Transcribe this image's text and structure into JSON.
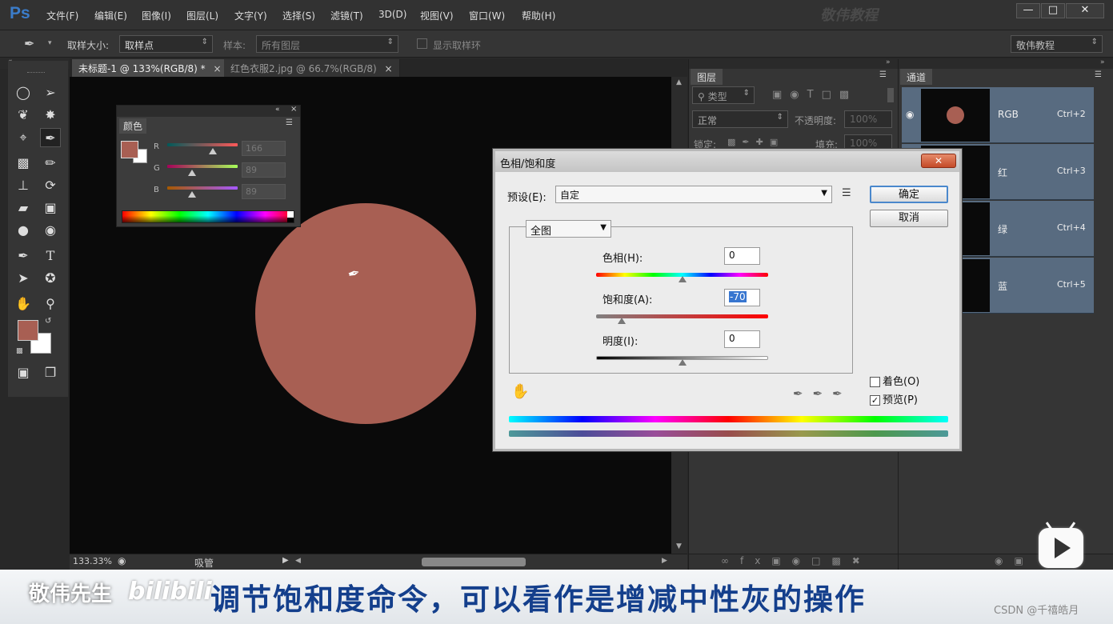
{
  "app": {
    "logo": "Ps",
    "watermark_top": "敬伟教程",
    "window_controls": [
      "—",
      "□",
      "✕"
    ]
  },
  "menu": [
    "文件(F)",
    "编辑(E)",
    "图像(I)",
    "图层(L)",
    "文字(Y)",
    "选择(S)",
    "滤镜(T)",
    "3D(D)",
    "视图(V)",
    "窗口(W)",
    "帮助(H)"
  ],
  "options": {
    "sample_size_label": "取样大小:",
    "sample_size_value": "取样点",
    "sample_label": "样本:",
    "sample_value": "所有图层",
    "show_ring_label": "显示取样环",
    "workspace_value": "敬伟教程"
  },
  "tabs": [
    {
      "label": "未标题-1 @ 133%(RGB/8) *",
      "active": true
    },
    {
      "label": "红色衣服2.jpg @ 66.7%(RGB/8)",
      "active": false
    }
  ],
  "status": {
    "zoom": "133.33%",
    "tool": "吸管"
  },
  "color_panel": {
    "title": "颜色",
    "foreground": "#a85f53",
    "background": "#ffffff",
    "sliders": [
      {
        "label": "R",
        "value": "166",
        "fraction": 0.65
      },
      {
        "label": "G",
        "value": "89",
        "fraction": 0.35
      },
      {
        "label": "B",
        "value": "89",
        "fraction": 0.35
      }
    ]
  },
  "canvas": {
    "circle_color": "#a85f53",
    "bg_color": "#0a0a0a"
  },
  "dialog": {
    "title": "色相/饱和度",
    "preset_label": "预设(E):",
    "preset_value": "自定",
    "channel_value": "全图",
    "hue_label": "色相(H):",
    "hue_value": "0",
    "hue_fraction": 0.5,
    "sat_label": "饱和度(A):",
    "sat_value": "-70",
    "sat_fraction": 0.15,
    "light_label": "明度(I):",
    "light_value": "0",
    "light_fraction": 0.5,
    "ok_label": "确定",
    "cancel_label": "取消",
    "colorize_label": "着色(O)",
    "colorize_checked": false,
    "preview_label": "预览(P)",
    "preview_checked": true
  },
  "layers_panel": {
    "title": "图层",
    "kind_label": "类型",
    "blend_mode": "正常",
    "opacity_label": "不透明度:",
    "opacity_value": "100%",
    "lock_label": "锁定:",
    "fill_label": "填充:",
    "fill_value": "100%"
  },
  "channels_panel": {
    "title": "通道",
    "channels": [
      {
        "name": "RGB",
        "shortcut": "Ctrl+2"
      },
      {
        "name": "红",
        "shortcut": "Ctrl+3"
      },
      {
        "name": "绿",
        "shortcut": "Ctrl+4"
      },
      {
        "name": "蓝",
        "shortcut": "Ctrl+5"
      }
    ]
  },
  "caption": {
    "text": "调节饱和度命令，可以看作是增减中性灰的操作",
    "left_text": "敬伟先生",
    "bili_text": "bilibili",
    "credit": "CSDN @千禧皓月"
  }
}
